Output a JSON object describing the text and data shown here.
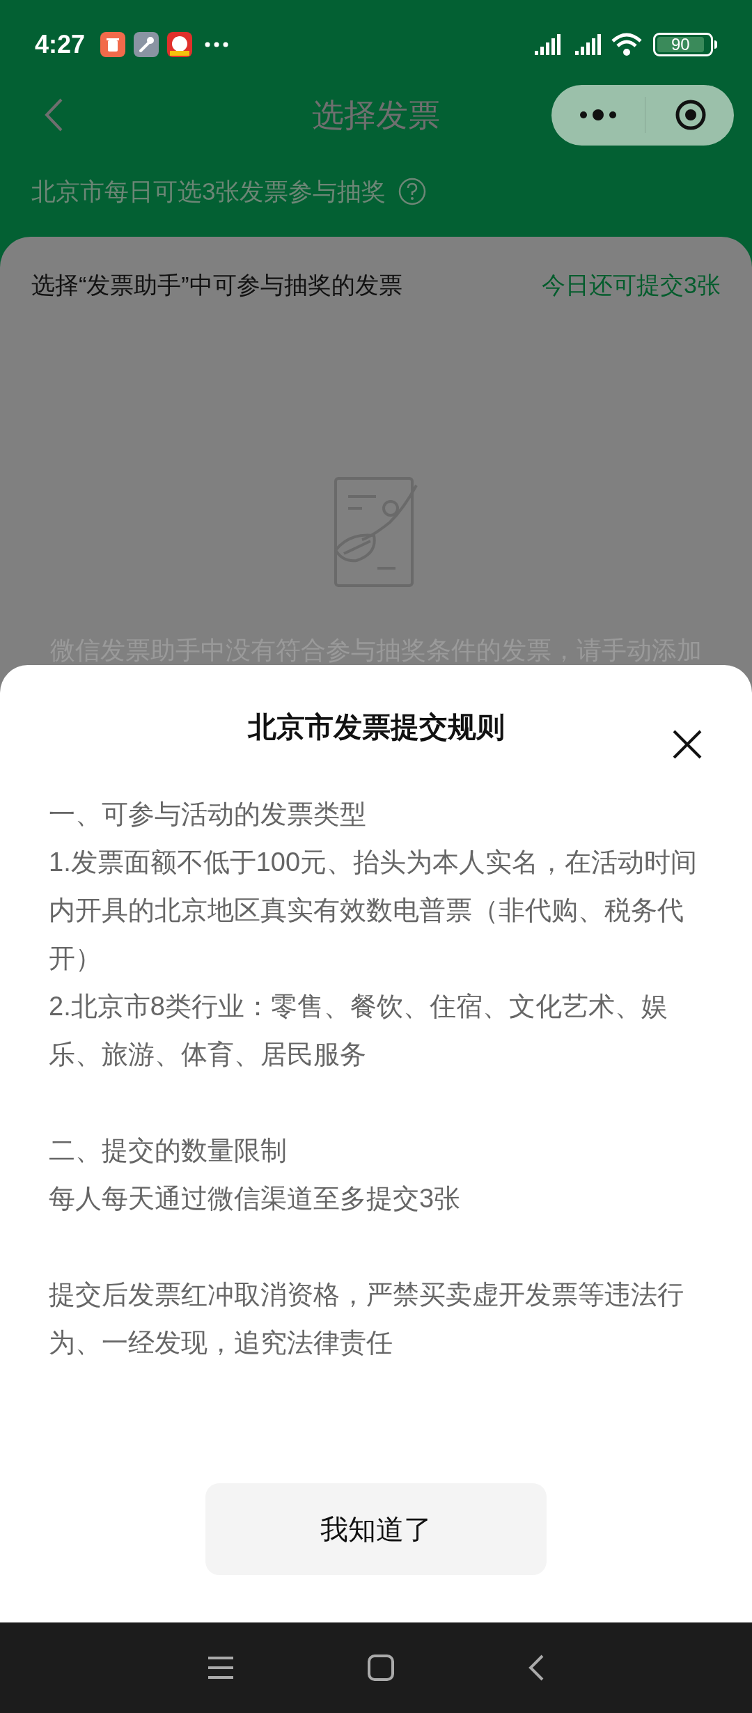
{
  "status_bar": {
    "time": "4:27",
    "battery": "90"
  },
  "header": {
    "title": "选择发票"
  },
  "notice": {
    "text": "北京市每日可选3张发票参与抽奖"
  },
  "card": {
    "title": "选择“发票助手”中可参与抽奖的发票",
    "remaining": "今日还可提交3张",
    "empty_text": "微信发票助手中没有符合参与抽奖条件的发票，请手动添加"
  },
  "sheet": {
    "title": "北京市发票提交规则",
    "groups": [
      [
        "一、可参与活动的发票类型",
        "1.发票面额不低于100元、抬头为本人实名，在活动时间内开具的北京地区真实有效数电普票（非代购、税务代开）",
        "2.北京市8类行业：零售、餐饮、住宿、文化艺术、娱乐、旅游、体育、居民服务"
      ],
      [
        "二、提交的数量限制",
        "每人每天通过微信渠道至多提交3张"
      ],
      [
        "提交后发票红冲取消资格，严禁买卖虚开发票等违法行为、一经发现，追究法律责任"
      ]
    ],
    "button": "我知道了"
  }
}
